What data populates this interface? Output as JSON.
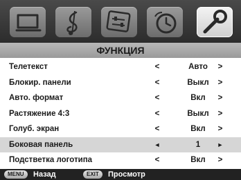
{
  "header": {
    "tabs": [
      {
        "icon": "tv-screen-icon"
      },
      {
        "icon": "music-note-icon"
      },
      {
        "icon": "settings-sliders-icon"
      },
      {
        "icon": "clock-icon"
      },
      {
        "icon": "wrench-icon",
        "active": true
      }
    ],
    "title": "ФУНКЦИЯ"
  },
  "menu": {
    "rows": [
      {
        "label": "Телетекст",
        "left_arrow": "<",
        "value": "Авто",
        "right_arrow": ">"
      },
      {
        "label": "Блокир. панели",
        "left_arrow": "<",
        "value": "Выкл",
        "right_arrow": ">"
      },
      {
        "label": "Авто. формат",
        "left_arrow": "<",
        "value": "Вкл",
        "right_arrow": ">"
      },
      {
        "label": "Растяжение 4:3",
        "left_arrow": "<",
        "value": "Выкл",
        "right_arrow": ">"
      },
      {
        "label": "Голуб. экран",
        "left_arrow": "<",
        "value": "Вкл",
        "right_arrow": ">"
      },
      {
        "label": "Боковая панель",
        "left_arrow": "◄",
        "value": "1",
        "right_arrow": "►",
        "selected": true
      },
      {
        "label": "Подстветка логотипа",
        "left_arrow": "<",
        "value": "Вкл",
        "right_arrow": ">"
      }
    ]
  },
  "footer": {
    "menu_key": "MENU",
    "menu_label": "Назад",
    "exit_key": "EXIT",
    "exit_label": "Просмотр"
  },
  "colors": {
    "icon_bar": "#3a3a3a",
    "title_strip": "#a8a8a8",
    "selected_row": "#d6d6d6",
    "footer": "#222222"
  }
}
